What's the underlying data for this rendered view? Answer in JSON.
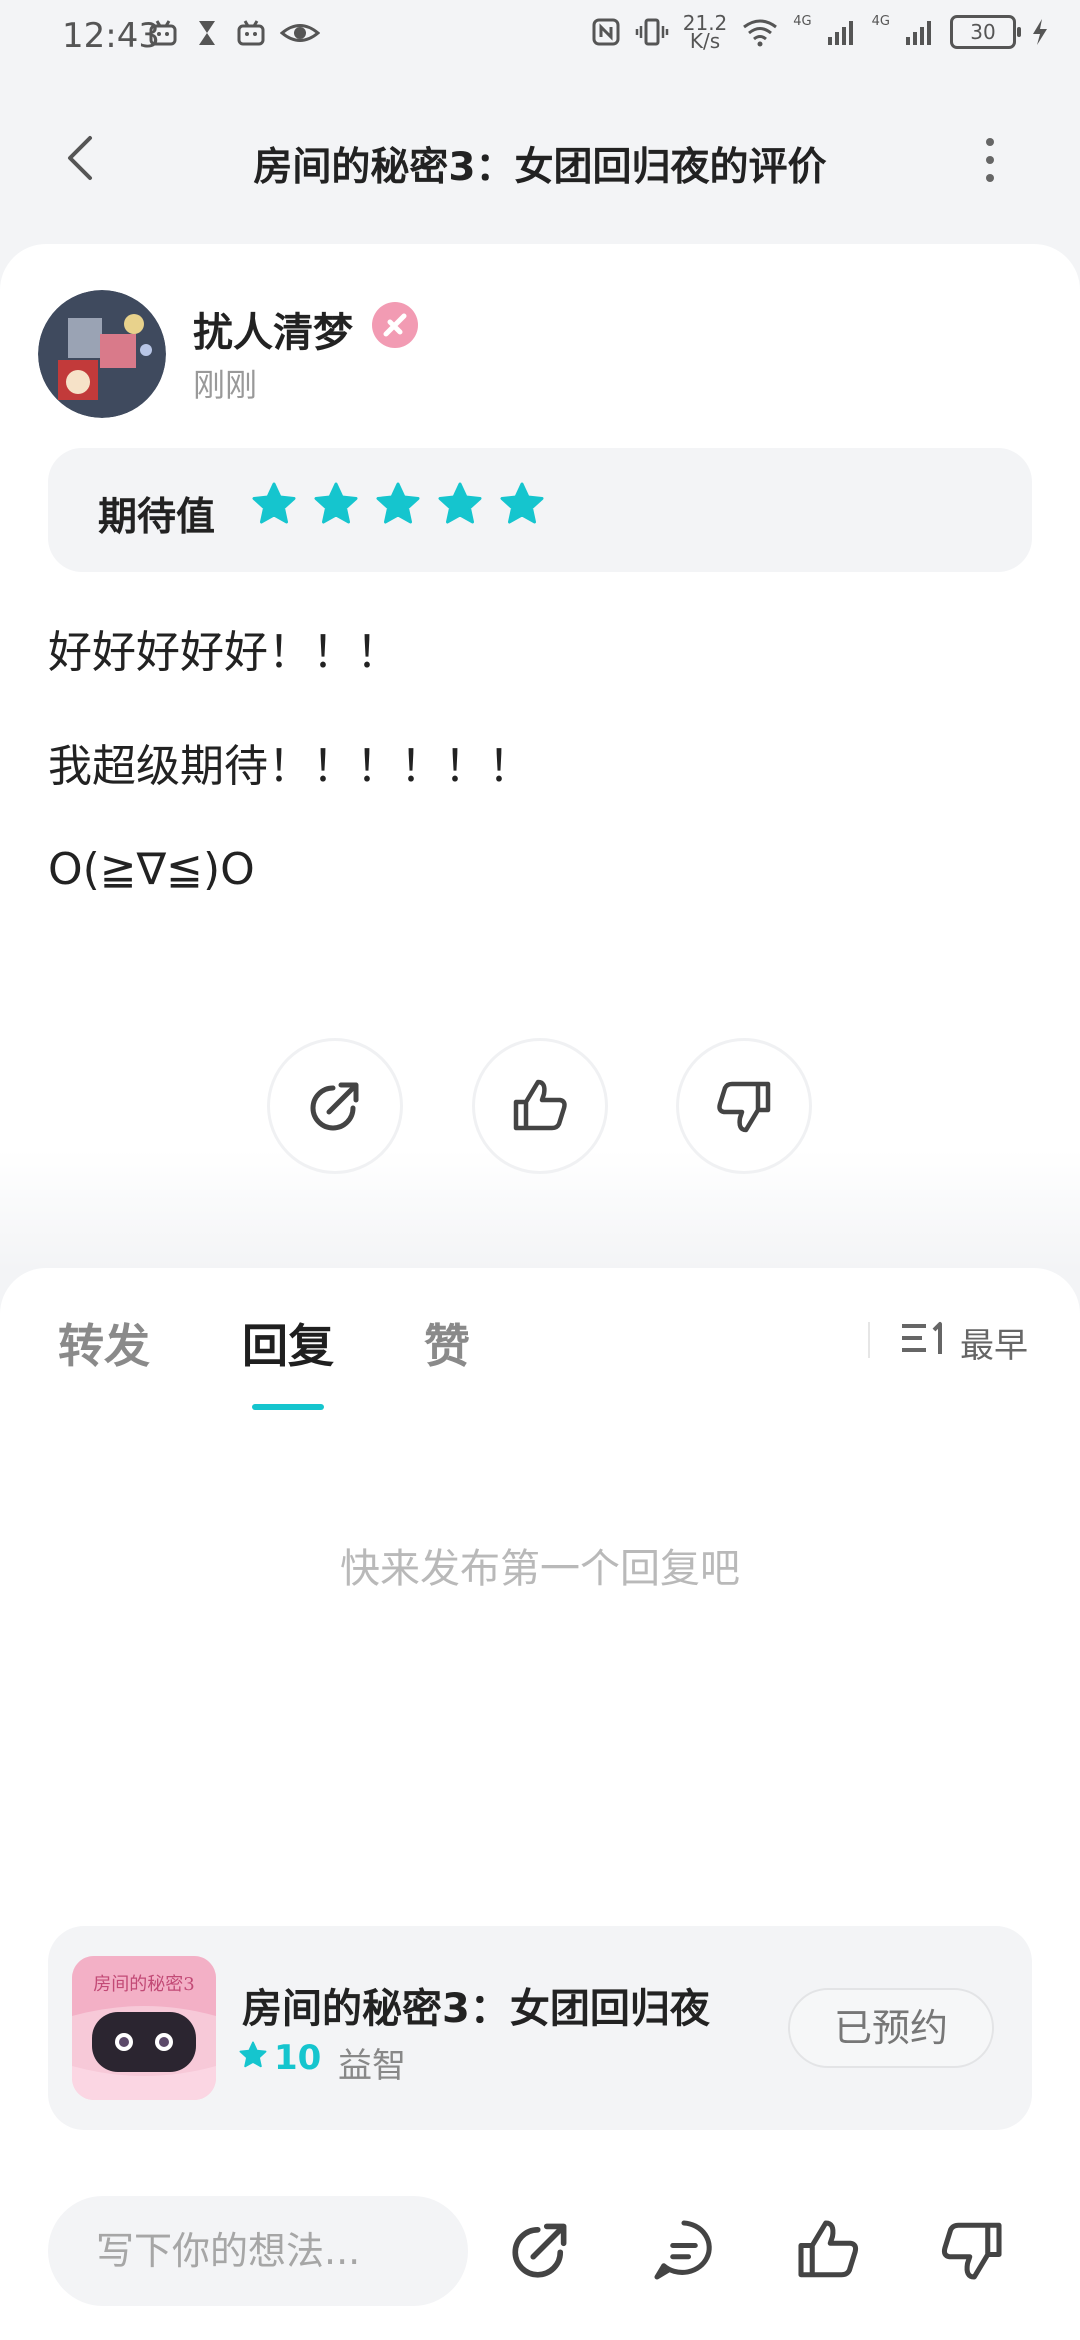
{
  "status_bar": {
    "time": "12:43",
    "net_speed_value": "21.2",
    "net_speed_unit": "K/s",
    "network_1": "4G",
    "network_2": "4G",
    "battery": "30"
  },
  "nav": {
    "title": "房间的秘密3：女团回归夜的评价"
  },
  "review": {
    "username": "扰人清梦",
    "time": "刚刚",
    "expect_label": "期待值",
    "stars": 5,
    "lines": [
      "好好好好好！！！",
      "我超级期待！！！！！！",
      "O(≧∇≦)O"
    ]
  },
  "tabs": {
    "items": [
      "转发",
      "回复",
      "赞"
    ],
    "active_index": 1,
    "sort_label": "最早"
  },
  "empty_text": "快来发布第一个回复吧",
  "game": {
    "cover_text": "房间的秘密3",
    "title": "房间的秘密3：女团回归夜",
    "score": "10",
    "tag": "益智",
    "reserve_label": "已预约"
  },
  "bottom": {
    "input_placeholder": "写下你的想法..."
  },
  "colors": {
    "accent": "#15c5ce",
    "background": "#f3f4f6"
  }
}
